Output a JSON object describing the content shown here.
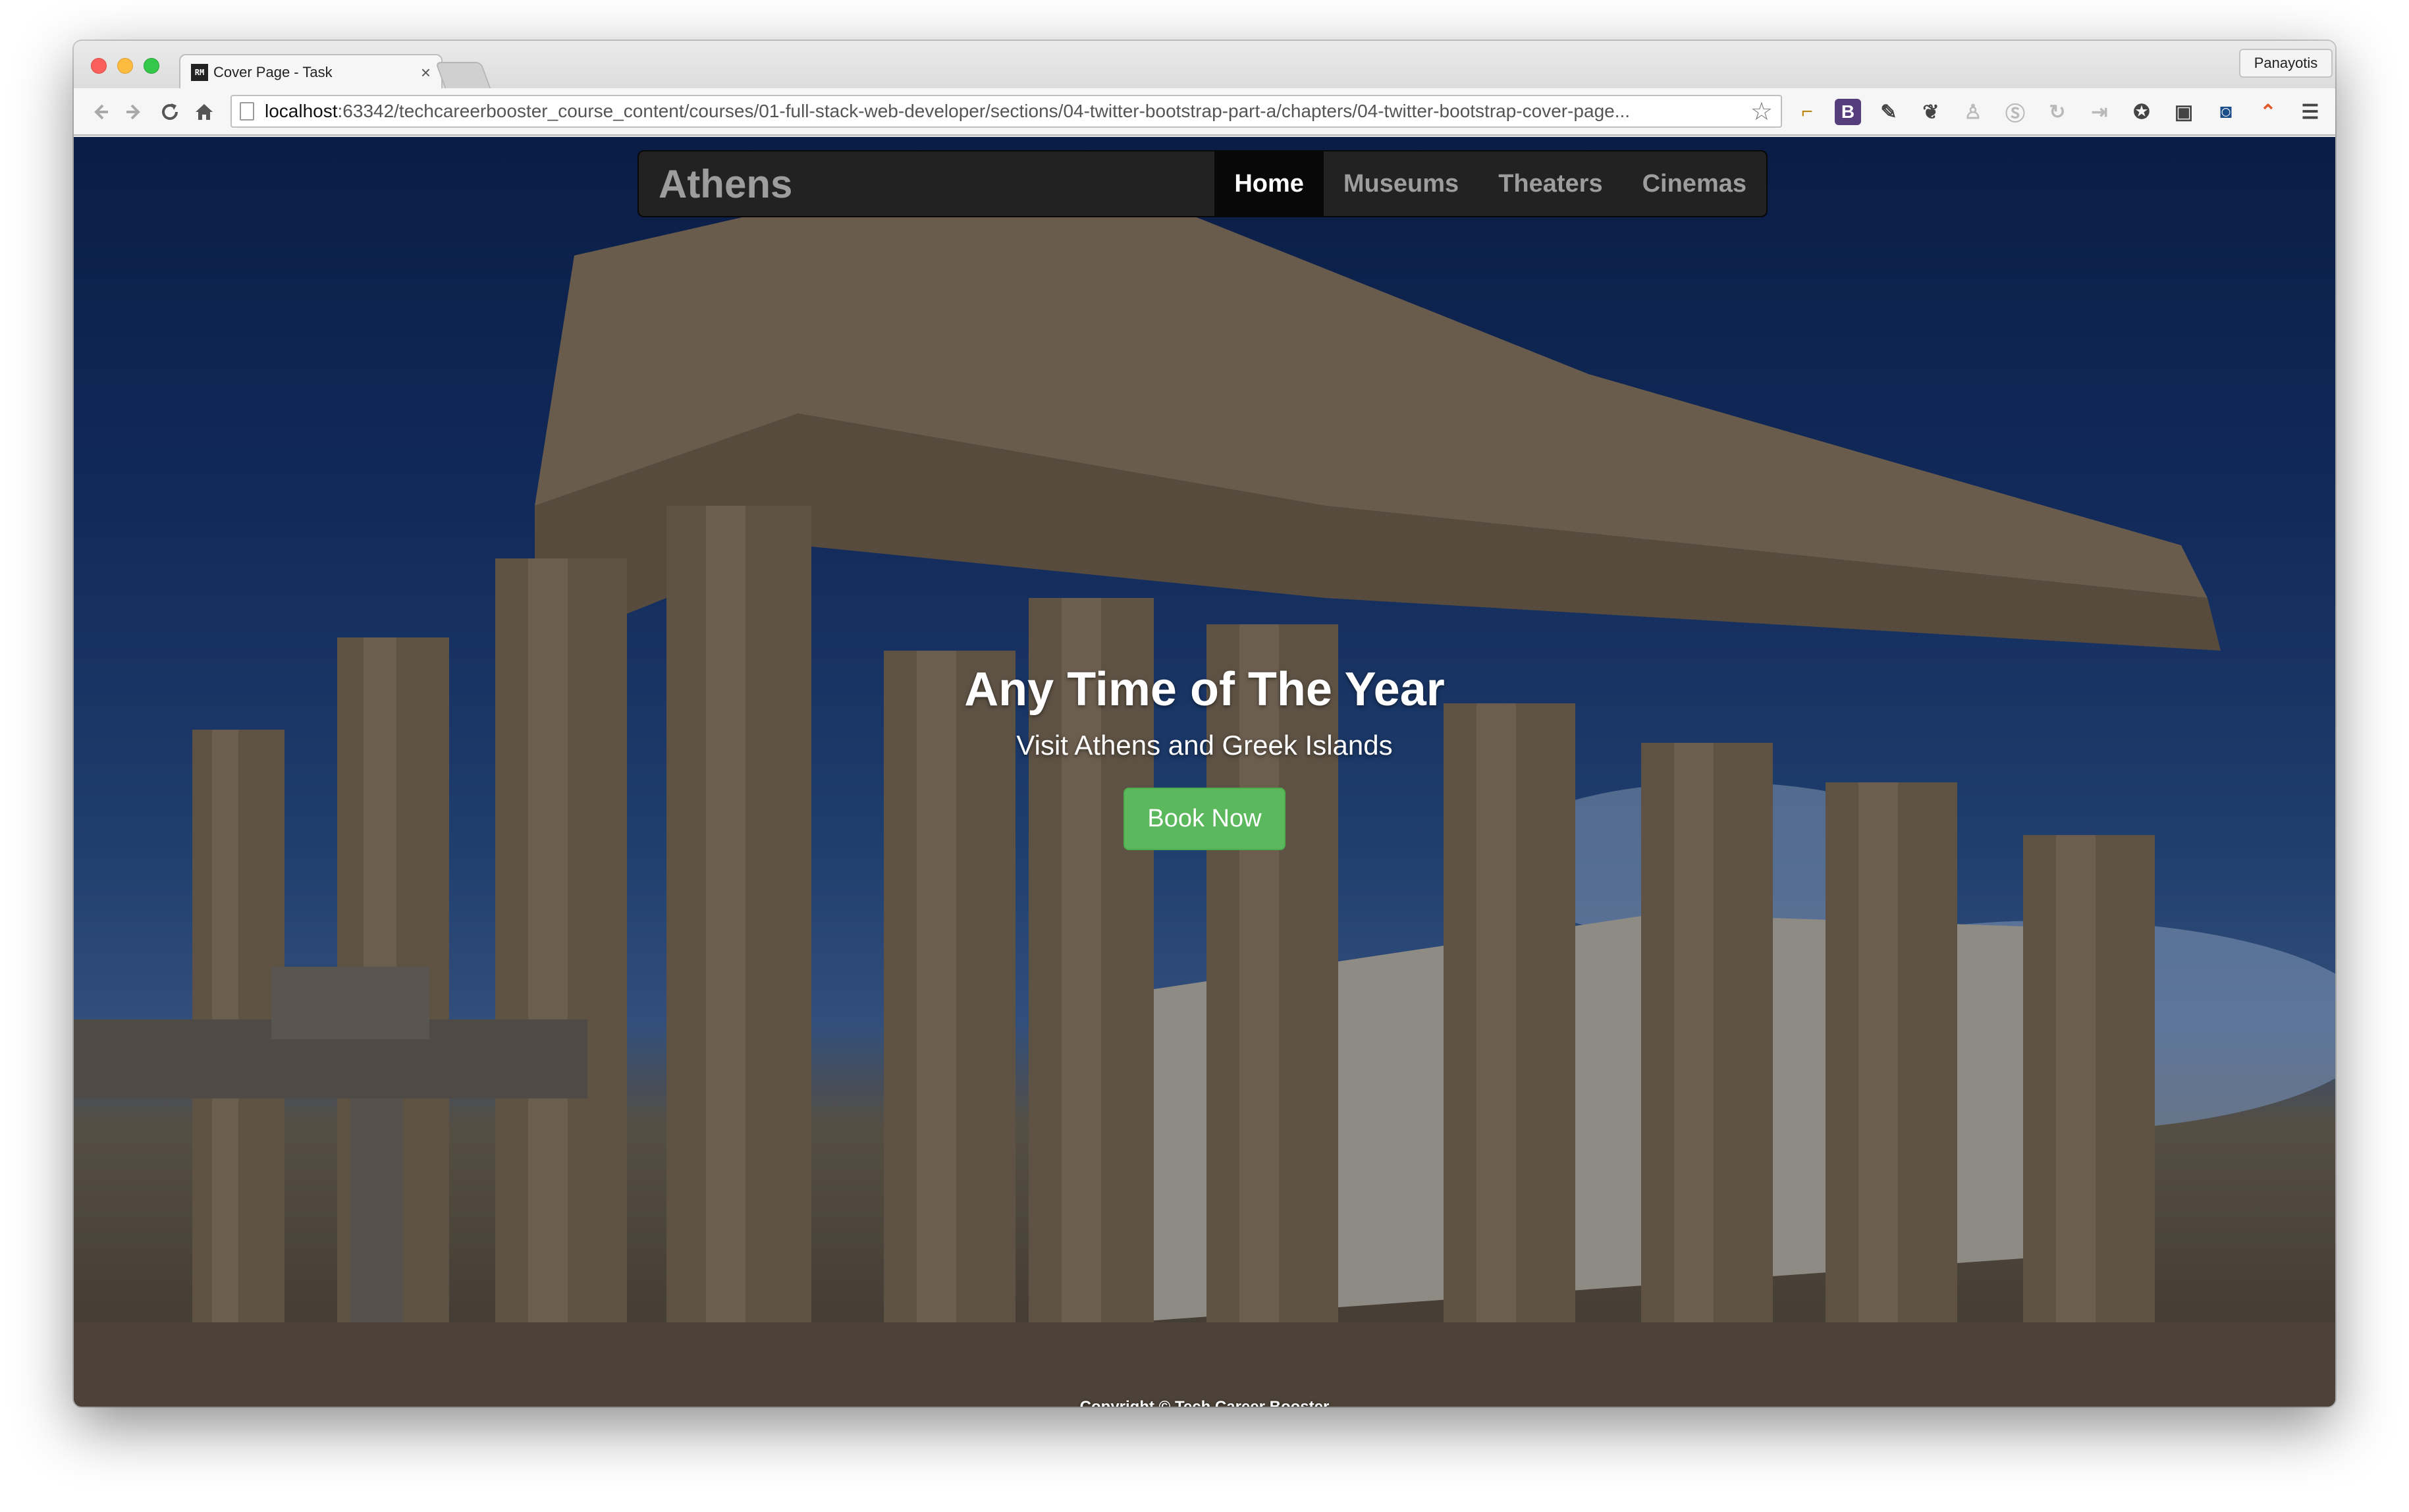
{
  "browser": {
    "tab_favicon": "RM",
    "tab_title": "Cover Page - Task",
    "tab_close": "×",
    "profile_name": "Panayotis",
    "url_host": "localhost",
    "url_rest": ":63342/techcareerbooster_course_content/courses/01-full-stack-web-developer/sections/04-twitter-bootstrap-part-a/chapters/04-twitter-bootstrap-cover-page...",
    "icons": {
      "back": "back-arrow-icon",
      "forward": "forward-arrow-icon",
      "reload": "reload-icon",
      "home": "home-icon",
      "bookmark": "star-icon",
      "menu": "hamburger-menu-icon"
    },
    "extensions": [
      "bookmark-ext-icon",
      "bootstrap-ext-icon",
      "eyedropper-ext-icon",
      "evernote-ext-icon",
      "ext-icon-5",
      "skype-ext-icon",
      "ext-icon-7",
      "ext-icon-8",
      "ext-icon-9",
      "ext-icon-10",
      "ext-icon-11",
      "ext-icon-12"
    ],
    "bootstrap_ext_label": "B"
  },
  "page": {
    "brand": "Athens",
    "nav": [
      {
        "label": "Home",
        "active": true
      },
      {
        "label": "Museums",
        "active": false
      },
      {
        "label": "Theaters",
        "active": false
      },
      {
        "label": "Cinemas",
        "active": false
      }
    ],
    "hero_title": "Any Time of The Year",
    "hero_subtitle": "Visit Athens and Greek Islands",
    "cta_label": "Book Now",
    "footer_text": "Copyright © Tech Career Booster",
    "colors": {
      "navbar_bg": "#222222",
      "active_nav_bg": "#080808",
      "cta_bg": "#5cb85c"
    }
  }
}
